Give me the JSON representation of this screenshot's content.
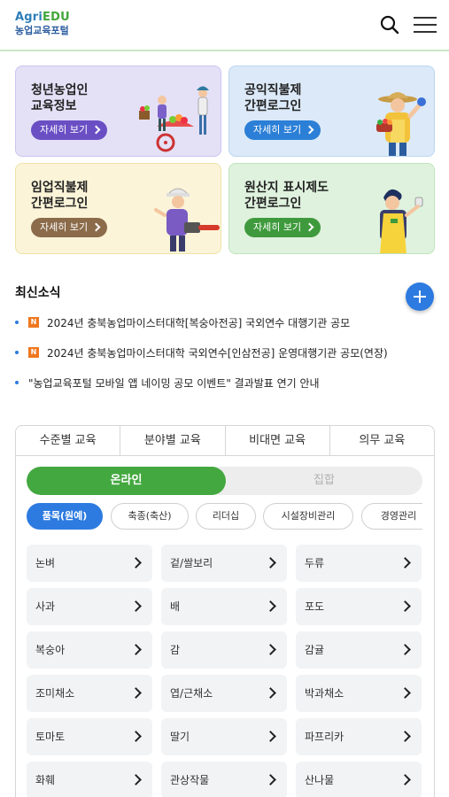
{
  "header": {
    "logo_agri": "Agri",
    "logo_edu": "EDU",
    "logo_sub": "농업교육포털"
  },
  "cards": [
    {
      "title": "청년농업인\n교육정보",
      "button": "자세히 보기",
      "bg": "#e4e1f7",
      "border": "#cbc5ef",
      "btn_color": "#6a4fc4"
    },
    {
      "title": "공익직불제\n간편로그인",
      "button": "자세히 보기",
      "bg": "#dbe9f8",
      "border": "#bcd6f1",
      "btn_color": "#2c7fd6"
    },
    {
      "title": "임업직불제\n간편로그인",
      "button": "자세히 보기",
      "bg": "#fbf4d8",
      "border": "#efe3a6",
      "btn_color": "#8b6b4a"
    },
    {
      "title": "원산지 표시제도\n간편로그인",
      "button": "자세히 보기",
      "bg": "#dff2de",
      "border": "#bfe3bc",
      "btn_color": "#3e9a3c"
    }
  ],
  "news": {
    "title": "최신소식",
    "badge": "N",
    "items": [
      {
        "text": "2024년 충북농업마이스터대학[복숭아전공] 국외연수 대행기관 공모",
        "new": true
      },
      {
        "text": "2024년 충북농업마이스터대학 국외연수[인삼전공] 운영대행기관 공모(연장)",
        "new": true
      },
      {
        "text": "\"농업교육포털 모바일 앱 네이밍 공모 이벤트\" 결과발표 연기 안내",
        "new": false
      }
    ]
  },
  "tabs": [
    "수준별 교육",
    "분야별 교육",
    "비대면 교육",
    "의무 교육"
  ],
  "segment": {
    "on": "온라인",
    "off": "집합"
  },
  "chips": [
    "품목(원예)",
    "축종(축산)",
    "리더십",
    "시설장비관리",
    "경영관리"
  ],
  "grid": [
    [
      "논벼",
      "겉/쌀보리",
      "두류"
    ],
    [
      "사과",
      "배",
      "포도"
    ],
    [
      "복숭아",
      "감",
      "감귤"
    ],
    [
      "조미채소",
      "엽/근채소",
      "박과채소"
    ],
    [
      "토마토",
      "딸기",
      "파프리카"
    ],
    [
      "화훼",
      "관상작물",
      "산나물"
    ]
  ],
  "colors": {
    "accent_green": "#43a83f",
    "accent_blue": "#2d7be0",
    "badge_orange": "#f0771f"
  },
  "icons": {
    "search": "search-icon",
    "menu": "hamburger-menu-icon",
    "add": "plus-icon"
  }
}
